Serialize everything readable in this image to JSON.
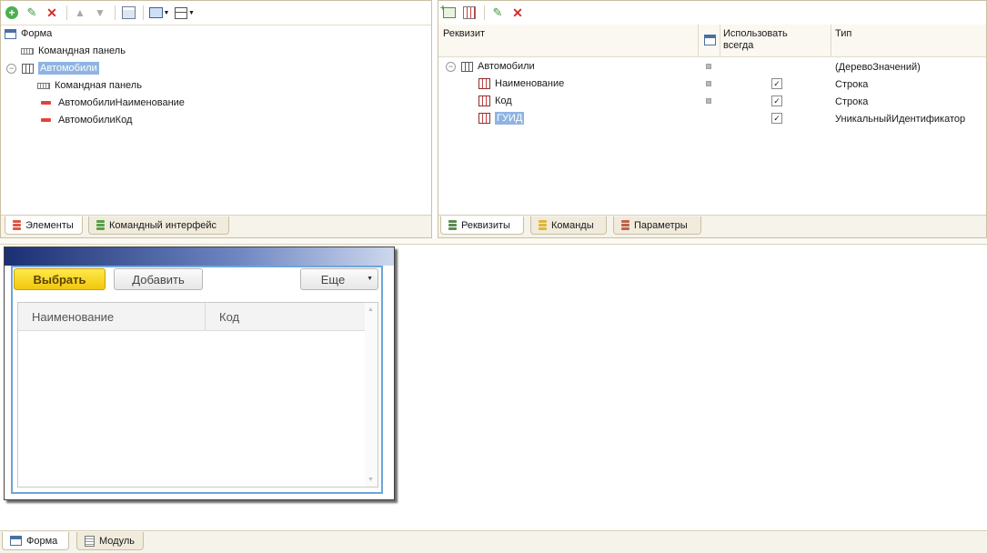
{
  "elements_panel": {
    "tree": [
      {
        "label": "Форма",
        "icon": "form-icon"
      },
      {
        "label": "Командная панель",
        "icon": "command-panel-icon"
      },
      {
        "label": "Автомобили",
        "icon": "table-icon",
        "selected": true
      },
      {
        "label": "Командная панель",
        "icon": "command-panel-icon"
      },
      {
        "label": "АвтомобилиНаименование",
        "icon": "field-icon"
      },
      {
        "label": "АвтомобилиКод",
        "icon": "field-icon"
      }
    ],
    "tabs": [
      {
        "label": "Элементы",
        "active": true
      },
      {
        "label": "Командный интерфейс",
        "active": false
      }
    ]
  },
  "attributes_panel": {
    "columns": {
      "attribute": "Реквизит",
      "use_always": "Использовать всегда",
      "use_always_line1": "Использовать",
      "use_always_line2": "всегда",
      "type": "Тип"
    },
    "rows": [
      {
        "name": "Автомобили",
        "type": "(ДеревоЗначений)",
        "checked": false
      },
      {
        "name": "Наименование",
        "type": "Строка",
        "checked": true
      },
      {
        "name": "Код",
        "type": "Строка",
        "checked": true
      },
      {
        "name": "ГУИД",
        "type": "УникальныйИдентификатор",
        "checked": true,
        "selected": true
      }
    ],
    "tabs": [
      {
        "label": "Реквизиты",
        "active": true
      },
      {
        "label": "Команды",
        "active": false
      },
      {
        "label": "Параметры",
        "active": false
      }
    ]
  },
  "form_preview": {
    "buttons": {
      "select": "Выбрать",
      "add": "Добавить",
      "more": "Еще"
    },
    "columns": {
      "name": "Наименование",
      "code": "Код"
    }
  },
  "bottom_tabs": [
    {
      "label": "Форма",
      "active": true
    },
    {
      "label": "Модуль",
      "active": false
    }
  ],
  "colors": {
    "selection": "#8fb4e3",
    "accent_yellow": "#f2c70c",
    "frame_blue": "#6fa4d8"
  }
}
